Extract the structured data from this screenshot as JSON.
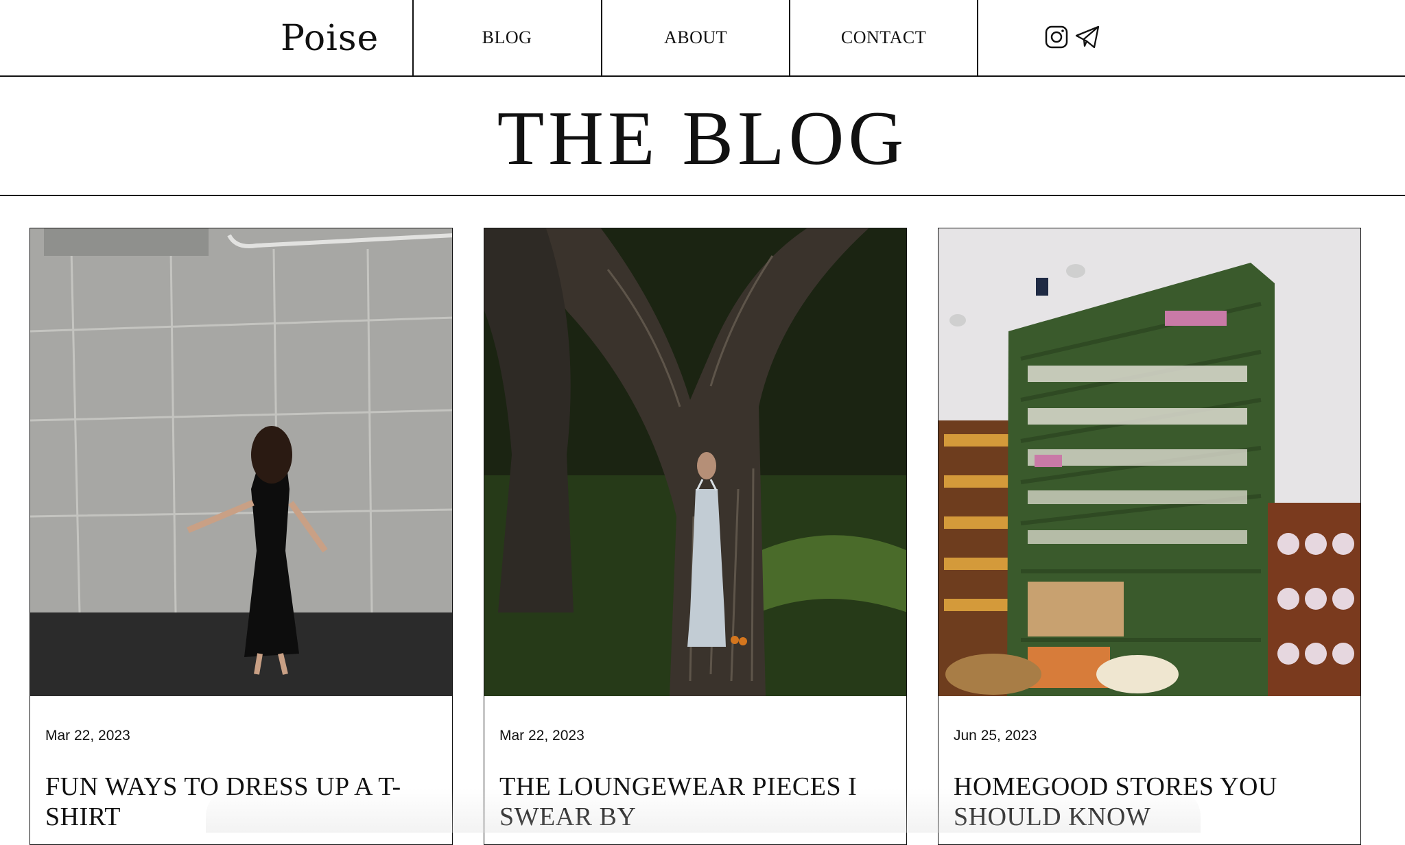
{
  "site": {
    "logo": "Poise"
  },
  "nav": {
    "items": [
      {
        "label": "BLOG"
      },
      {
        "label": "ABOUT"
      },
      {
        "label": "CONTACT"
      }
    ],
    "social": [
      "instagram-icon",
      "telegram-icon"
    ]
  },
  "page": {
    "title": "THE BLOG"
  },
  "posts": [
    {
      "date": "Mar 22, 2023",
      "title": "FUN WAYS TO DRESS UP A T-SHIRT",
      "image": "woman in black dress dancing by concrete wall"
    },
    {
      "date": "Mar 22, 2023",
      "title": "THE LOUNGEWEAR PIECES I SWEAR BY",
      "image": "woman in white slip dress under large tree"
    },
    {
      "date": "Jun 25, 2023",
      "title": "HOMEGOOD STORES YOU SHOULD KNOW",
      "image": "green shelves in a homegoods store"
    }
  ],
  "colors": {
    "text": "#111111",
    "background": "#ffffff",
    "border": "#111111"
  }
}
